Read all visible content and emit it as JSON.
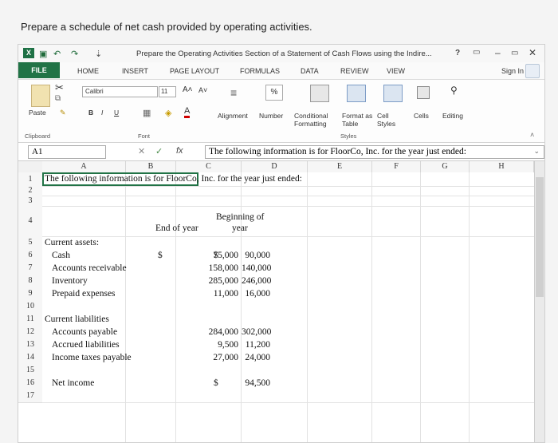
{
  "prompt": "Prepare a schedule of net cash provided by operating activities.",
  "window": {
    "app_icon": "X",
    "title": "Prepare the Operating Activities Section of a Statement of Cash Flows using the Indire...",
    "help": "?",
    "minimize": "–",
    "restore": "▭",
    "close": "✕"
  },
  "tabs": [
    "FILE",
    "HOME",
    "INSERT",
    "PAGE LAYOUT",
    "FORMULAS",
    "DATA",
    "REVIEW",
    "VIEW"
  ],
  "signin": "Sign In",
  "ribbon": {
    "paste": "Paste",
    "clipboard": "Clipboard",
    "font_name": "Calibri",
    "font_size": "11",
    "font_group": "Font",
    "bold": "B",
    "italic": "I",
    "underline": "U",
    "alignment": "Alignment",
    "number": "Number",
    "percent": "%",
    "cond_format": "Conditional Formatting",
    "format_as_table": "Format as Table",
    "cell_styles": "Cell Styles",
    "styles_group": "Styles",
    "cells": "Cells",
    "editing": "Editing"
  },
  "formula_bar": {
    "name_box": "A1",
    "fx": "fx",
    "content": "The following information is for FloorCo, Inc. for the year just ended:"
  },
  "columns": [
    "A",
    "B",
    "C",
    "D",
    "E",
    "F",
    "G",
    "H"
  ],
  "rows": [
    {
      "n": "1",
      "a": "The following information is for FloorCo, Inc. for the year just ended:",
      "b": "",
      "c": "",
      "d": ""
    },
    {
      "n": "2",
      "a": "",
      "b": "",
      "c": "",
      "d": ""
    },
    {
      "n": "3",
      "a": "",
      "b": "",
      "c": "",
      "d": ""
    },
    {
      "n": "4",
      "a": "",
      "b": "",
      "c": "End of year",
      "d": "Beginning of year"
    },
    {
      "n": "5",
      "a": "Current assets:",
      "b": "",
      "c": "",
      "d": ""
    },
    {
      "n": "6",
      "a": "Cash",
      "b": "$",
      "c": "75,000",
      "d": "90,000",
      "dsym": "$"
    },
    {
      "n": "7",
      "a": "Accounts receivable",
      "c": "158,000",
      "d": "140,000"
    },
    {
      "n": "8",
      "a": "Inventory",
      "c": "285,000",
      "d": "246,000"
    },
    {
      "n": "9",
      "a": "Prepaid expenses",
      "c": "11,000",
      "d": "16,000"
    },
    {
      "n": "10",
      "a": ""
    },
    {
      "n": "11",
      "a": "Current liabilities"
    },
    {
      "n": "12",
      "a": "Accounts payable",
      "c": "284,000",
      "d": "302,000"
    },
    {
      "n": "13",
      "a": "Accrued liabilities",
      "c": "9,500",
      "d": "11,200"
    },
    {
      "n": "14",
      "a": "Income taxes payable",
      "c": "27,000",
      "d": "24,000"
    },
    {
      "n": "15",
      "a": ""
    },
    {
      "n": "16",
      "a": "Net income",
      "dsym": "$",
      "d": "94,500"
    },
    {
      "n": "17",
      "a": ""
    }
  ],
  "header_c4": "End of year",
  "header_d4a": "Beginning of",
  "header_d4b": "year"
}
